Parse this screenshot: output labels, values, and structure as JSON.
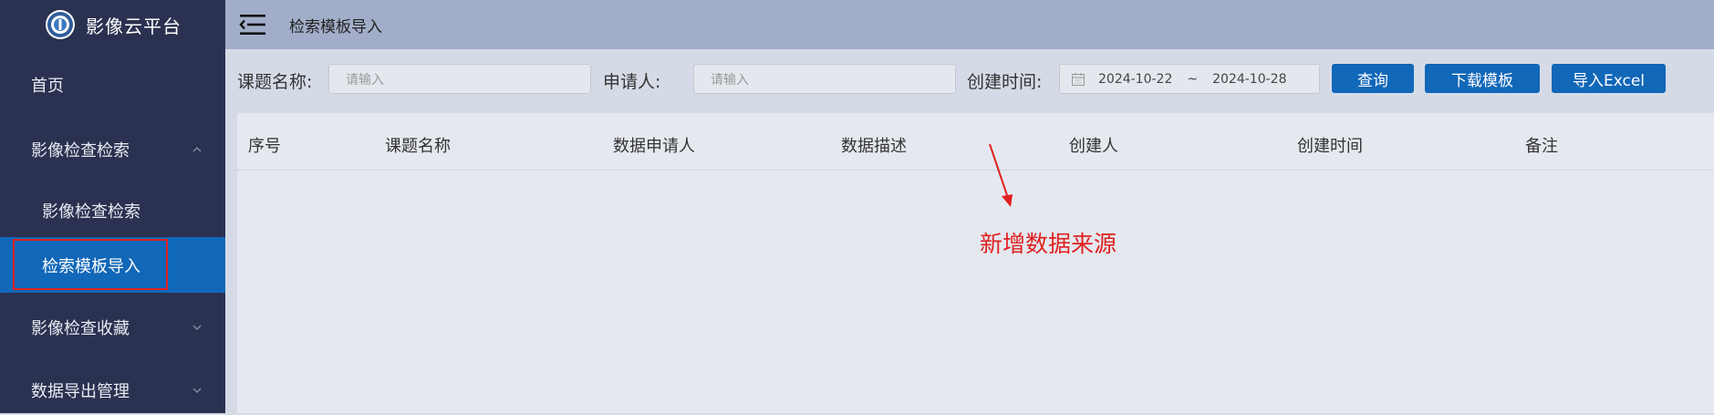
{
  "app": {
    "title": "影像云平台"
  },
  "sidebar": {
    "items": [
      {
        "label": "首页"
      },
      {
        "label": "影像检查检索"
      },
      {
        "label": "影像检查检索"
      },
      {
        "label": "检索模板导入"
      },
      {
        "label": "影像检查收藏"
      },
      {
        "label": "数据导出管理"
      }
    ]
  },
  "header": {
    "breadcrumb": "检索模板导入"
  },
  "filters": {
    "topic_label": "课题名称:",
    "topic_placeholder": "请输入",
    "applicant_label": "申请人:",
    "applicant_placeholder": "请输入",
    "created_label": "创建时间:",
    "date_start": "2024-10-22",
    "date_sep": "~",
    "date_end": "2024-10-28"
  },
  "buttons": {
    "query": "查询",
    "download_template": "下载模板",
    "import_excel": "导入Excel"
  },
  "table": {
    "columns": [
      "序号",
      "课题名称",
      "数据申请人",
      "数据描述",
      "创建人",
      "创建时间",
      "备注"
    ]
  },
  "annotation": {
    "text": "新增数据来源",
    "color": "#e02020"
  },
  "colors": {
    "sidebar": "#2b3150",
    "accent": "#1167b8",
    "header": "#a2aec9"
  }
}
